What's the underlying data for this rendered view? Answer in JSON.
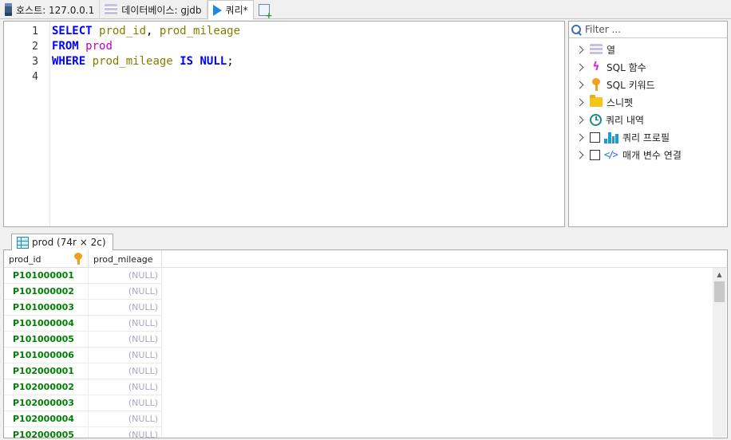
{
  "tabs": [
    {
      "label": "호스트: 127.0.0.1",
      "icon": "server-icon"
    },
    {
      "label": "데이터베이스: gjdb",
      "icon": "database-icon"
    },
    {
      "label": "쿼리*",
      "icon": "play-icon"
    }
  ],
  "editor": {
    "line_numbers": [
      "1",
      "2",
      "3",
      "4"
    ],
    "line1": {
      "kw1": "SELECT",
      "col1": "prod_id",
      "sep": ", ",
      "col2": "prod_mileage"
    },
    "line2": {
      "kw": "FROM",
      "table": "prod"
    },
    "line3": {
      "kw1": "WHERE",
      "col": "prod_mileage",
      "kw2": "IS NULL",
      "end": ";"
    }
  },
  "side": {
    "filter_placeholder": "Filter ...",
    "items": [
      {
        "label": "열",
        "icon": "columns-icon",
        "checkbox": false
      },
      {
        "label": "SQL 함수",
        "icon": "bolt-icon",
        "checkbox": false
      },
      {
        "label": "SQL 키워드",
        "icon": "key-icon",
        "checkbox": false
      },
      {
        "label": "스니펫",
        "icon": "folder-icon",
        "checkbox": false
      },
      {
        "label": "쿼리 내역",
        "icon": "clock-icon",
        "checkbox": false
      },
      {
        "label": "쿼리 프로필",
        "icon": "bar-chart-icon",
        "checkbox": true
      },
      {
        "label": "매개 변수 연결",
        "icon": "code-icon",
        "checkbox": true
      }
    ]
  },
  "results": {
    "tab_label": "prod (74r × 2c)",
    "columns": [
      "prod_id",
      "prod_mileage"
    ],
    "rows": [
      [
        "P101000001",
        "(NULL)"
      ],
      [
        "P101000002",
        "(NULL)"
      ],
      [
        "P101000003",
        "(NULL)"
      ],
      [
        "P101000004",
        "(NULL)"
      ],
      [
        "P101000005",
        "(NULL)"
      ],
      [
        "P101000006",
        "(NULL)"
      ],
      [
        "P102000001",
        "(NULL)"
      ],
      [
        "P102000002",
        "(NULL)"
      ],
      [
        "P102000003",
        "(NULL)"
      ],
      [
        "P102000004",
        "(NULL)"
      ],
      [
        "P102000005",
        "(NULL)"
      ]
    ]
  },
  "colors": {
    "keyword": "#0000ff",
    "identifier": "#808000",
    "table": "#c000c0",
    "id_value": "#008000",
    "null_value": "#a8a8c0"
  }
}
